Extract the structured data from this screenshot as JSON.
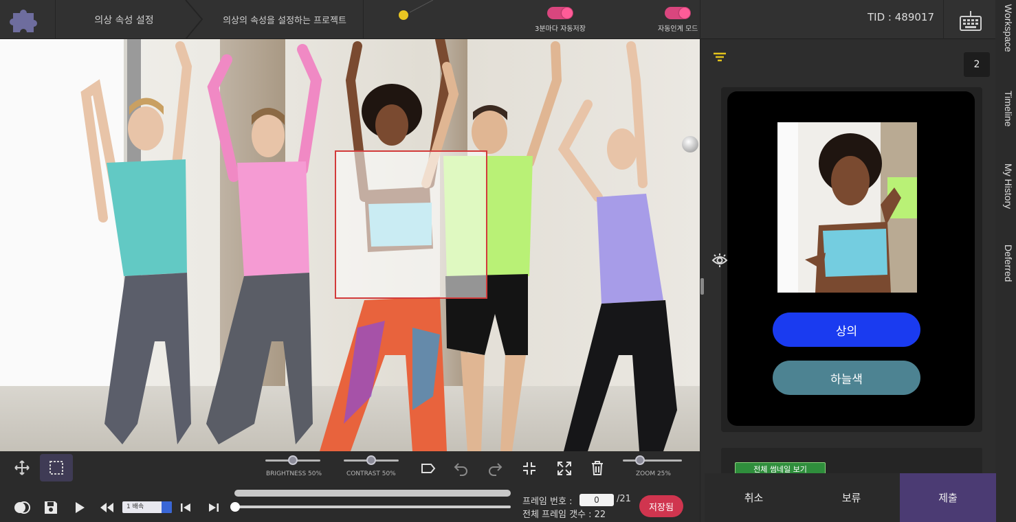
{
  "header": {
    "breadcrumb_1": "의상 속성 설정",
    "breadcrumb_2": "의상의 속성을 설정하는 프로젝트",
    "toggle_autosave_label": "3분마다 자동저장",
    "toggle_autoperson_label": "자동인계 모드",
    "toggle_autosave_on": true,
    "toggle_autoperson_on": true,
    "tid": "TID : 489017"
  },
  "side_tabs": [
    "Workspace",
    "Timeline",
    "My History",
    "Deferred"
  ],
  "toolbar": {
    "brightness_label": "BRIGHTNESS 50%",
    "brightness_value": 0.5,
    "contrast_label": "CONTRAST 50%",
    "contrast_value": 0.5,
    "zoom_label": "ZOOM 25%",
    "zoom_value": 0.25,
    "speed_label": "1 배속",
    "frame_number_label": "프레임 번호 :",
    "frame_number_value": "0",
    "frame_total_suffix": "/21",
    "total_frames_label": "전체 프레임 갯수 : 22",
    "save_label": "저장됨"
  },
  "right_panel": {
    "count": "2",
    "attribute_1": "상의",
    "attribute_2": "하늘색",
    "view_all_thumbnails": "전체 썸네일 보기",
    "cancel": "취소",
    "hold": "보류",
    "submit": "제출"
  },
  "colors": {
    "accent_pink": "#d9467e",
    "attr_blue": "#1a3bf0",
    "attr_teal": "#4d8392",
    "submit_purple": "#4b3b73",
    "bbox_red": "#d23a3a"
  }
}
